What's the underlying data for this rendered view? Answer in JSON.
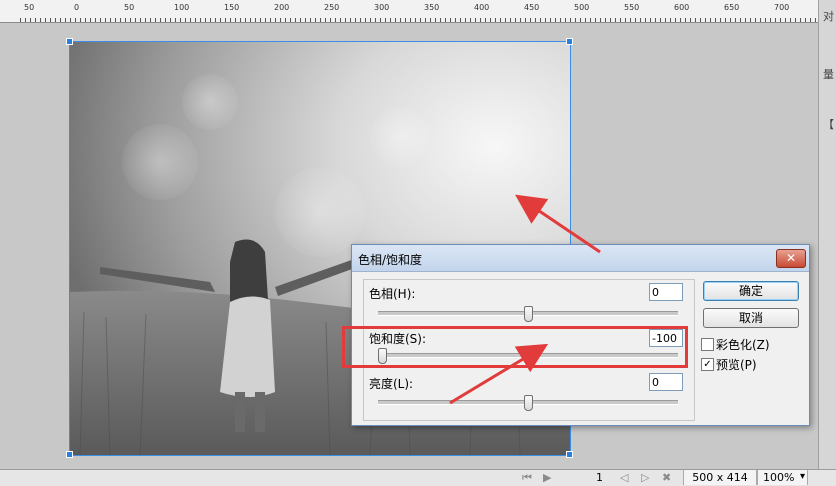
{
  "ruler": {
    "labels": [
      "50",
      "0",
      "50",
      "100",
      "150",
      "200",
      "250",
      "300",
      "350",
      "400",
      "450",
      "500",
      "550",
      "600",
      "650",
      "700"
    ]
  },
  "side_glyphs": [
    "对",
    "量",
    "【"
  ],
  "dialog": {
    "title": "色相/饱和度",
    "close_glyph": "✕",
    "hue": {
      "label": "色相(H):",
      "value": "0",
      "level": 0
    },
    "saturation": {
      "label": "饱和度(S):",
      "value": "-100",
      "level": -100
    },
    "lightness": {
      "label": "亮度(L):",
      "value": "0",
      "level": 0
    },
    "ok_label": "确定",
    "cancel_label": "取消",
    "colorize": {
      "label": "彩色化(Z)",
      "checked": false
    },
    "preview": {
      "label": "预览(P)",
      "checked": true,
      "mark": "✓"
    }
  },
  "status": {
    "first_glyph": "⏮",
    "play_glyph": "▶",
    "page": "1",
    "prev_glyph": "◁",
    "next_glyph": "▷",
    "close_glyph": "✖",
    "size": "500 x 414",
    "zoom": "100%",
    "zoom_arrow": "▾"
  },
  "colors": {
    "highlight": "#e23b3b",
    "arrow": "#e23b3b",
    "selection": "#2a7fe0"
  }
}
